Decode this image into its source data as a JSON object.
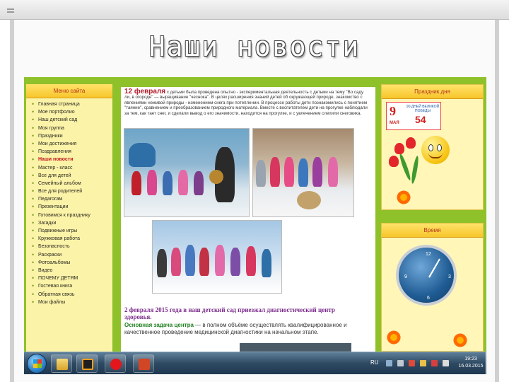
{
  "slide": {
    "title": "Наши новости"
  },
  "site": {
    "left_header": "Меню сайта",
    "menu": [
      "Главная страница",
      "Мое портфолио",
      "Наш детский сад",
      "Моя группа",
      "Праздники",
      "Мои достижения",
      "Поздравления",
      "Наши новости",
      "Мастер - класс",
      "Все для детей",
      "Семейный альбом",
      "Все для родителей",
      "Педагогам",
      "Презентации",
      "Готовимся к празднику",
      "Загадки",
      "Подвижные игры",
      "Кружковая работа",
      "Безопасность",
      "Раскраски",
      "Фотоальбомы",
      "Видео",
      "ПОЧЕМУ ДЕТЯМ",
      "Гостевая книга",
      "Обратная связь",
      "Мои файлы"
    ],
    "active_menu_index": 7,
    "news_1": {
      "date": "12 февраля",
      "text": "с детьми была проведена опытно - экспериментальная деятельность с детьми на тему \"Во саду ли, в огороде\" — выращивание \"чеснока\". В целях расширения знаний детей об окружающей природе, знакомство с явлениями неживой природы - изменением снега при потеплении. В процессе работы дети познакомились с понятием \"таяние\", сравнением и преобразованием природного материала. Вместе с воспитателем дети на прогулке наблюдали за тем, как тает снег, и сделали вывод о его значимости, находится на прогулке, и с увлечением слепили снеговика."
    },
    "news_2": {
      "headline": "2 февраля 2015 года в наш детский сад приезжал диагностический центр здоровья.",
      "lead": "Основная задача центра",
      "body": " — в полном объёме осуществлять квалифицированное и качественное проведение медицинской диагностики на начальном  этапе."
    },
    "right_header_1": "Праздник дня",
    "badge": {
      "nine": "9",
      "may": "МАЯ",
      "caption": "90 ДНЕЙ ВЕЛИКОЙ ПОБЕДЫ",
      "number": "54"
    },
    "right_header_2": "Время",
    "clock_numbers": {
      "n12": "12",
      "n3": "3",
      "n6": "6",
      "n9": "9"
    }
  },
  "taskbar": {
    "language": "RU",
    "time": "19:23",
    "date": "16.03.2015",
    "apps": [
      "windows-explorer-icon",
      "media-player-icon",
      "opera-icon",
      "powerpoint-icon"
    ]
  },
  "colors": {
    "site_green": "#8fc12b",
    "menu_bg": "#fbf3a8",
    "header_orange": "#f7c52a",
    "active_menu": "#c0141d",
    "date_red": "#b01d2a",
    "headline_purple": "#7a2a8a",
    "lead_green": "#1f7f1f"
  }
}
